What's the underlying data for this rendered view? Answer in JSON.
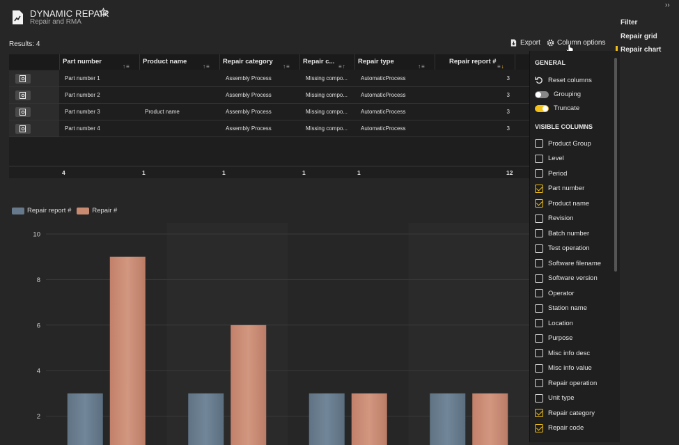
{
  "app": {
    "title": "DYNAMIC REPAIR",
    "subtitle": "Repair and RMA"
  },
  "nav": {
    "items": [
      "Filter",
      "Repair grid",
      "Repair chart"
    ],
    "active": "Repair chart"
  },
  "toolbar": {
    "results": "Results: 4",
    "export_label": "Export",
    "column_options_label": "Column options"
  },
  "grid": {
    "columns": [
      "Part number",
      "Product name",
      "Repair category",
      "Repair c...",
      "Repair type",
      "Repair report #"
    ],
    "rows": [
      [
        "Part number 1",
        "",
        "Assembly Process",
        "Missing compo...",
        "AutomaticProcess",
        "3"
      ],
      [
        "Part number 2",
        "",
        "Assembly Process",
        "Missing compo...",
        "AutomaticProcess",
        "3"
      ],
      [
        "Part number 3",
        "Product name",
        "Assembly Process",
        "Missing compo...",
        "AutomaticProcess",
        "3"
      ],
      [
        "Part number 4",
        "",
        "Assembly Process",
        "Missing compo...",
        "AutomaticProcess",
        "3"
      ]
    ],
    "footer": [
      "4",
      "1",
      "1",
      "1",
      "1",
      "12"
    ]
  },
  "panel": {
    "general_heading": "GENERAL",
    "reset_label": "Reset columns",
    "grouping_label": "Grouping",
    "grouping_on": false,
    "truncate_label": "Truncate",
    "truncate_on": true,
    "visible_heading": "VISIBLE COLUMNS",
    "columns": [
      {
        "label": "Product Group",
        "checked": false
      },
      {
        "label": "Level",
        "checked": false
      },
      {
        "label": "Period",
        "checked": false
      },
      {
        "label": "Part number",
        "checked": true
      },
      {
        "label": "Product name",
        "checked": true
      },
      {
        "label": "Revision",
        "checked": false
      },
      {
        "label": "Batch number",
        "checked": false
      },
      {
        "label": "Test operation",
        "checked": false
      },
      {
        "label": "Software filename",
        "checked": false
      },
      {
        "label": "Software version",
        "checked": false
      },
      {
        "label": "Operator",
        "checked": false
      },
      {
        "label": "Station name",
        "checked": false
      },
      {
        "label": "Location",
        "checked": false
      },
      {
        "label": "Purpose",
        "checked": false
      },
      {
        "label": "Misc info desc",
        "checked": false
      },
      {
        "label": "Misc info value",
        "checked": false
      },
      {
        "label": "Repair operation",
        "checked": false
      },
      {
        "label": "Unit type",
        "checked": false
      },
      {
        "label": "Repair category",
        "checked": true
      },
      {
        "label": "Repair code",
        "checked": true
      }
    ]
  },
  "chart_data": {
    "type": "bar",
    "title": "",
    "xlabel": "",
    "ylabel": "",
    "categories": [
      "",
      "",
      "",
      ""
    ],
    "series": [
      {
        "name": "Repair report #",
        "values": [
          3,
          3,
          3,
          3
        ],
        "color": "#667a8b"
      },
      {
        "name": "Repair #",
        "values": [
          9,
          6,
          3,
          3
        ],
        "color": "#c98a72"
      }
    ],
    "ylim": [
      0,
      10
    ],
    "yticks": [
      2,
      4,
      6,
      8,
      10
    ],
    "grid": true,
    "legend_position": "top-left"
  },
  "colors": {
    "accent": "#f2c01a",
    "background": "#262626"
  }
}
